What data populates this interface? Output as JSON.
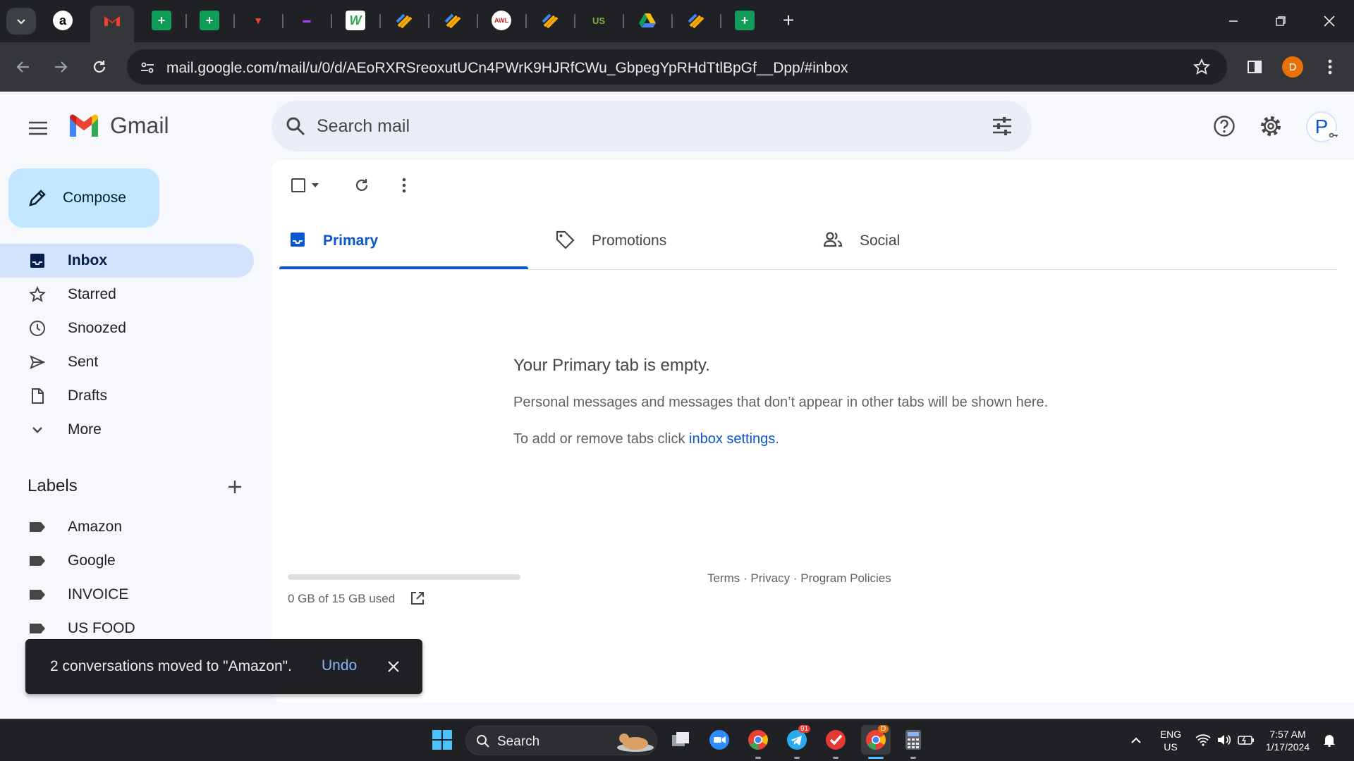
{
  "browser": {
    "url": "mail.google.com/mail/u/0/d/AEoRXRSreoxutUCn4PWrK9HJRfCWu_GbpegYpRHdTtlBpGf__Dpp/#inbox",
    "profile_initial": "D",
    "new_tab_symbol": "+",
    "tab_icons": [
      "amazon-icon",
      "gmail-icon",
      "sheets-icon",
      "sheets-icon",
      "app-icon",
      "app-icon",
      "w-icon",
      "app-icon",
      "app-icon",
      "awl-icon",
      "app-icon",
      "usfoods-icon",
      "drive-icon",
      "app-icon",
      "sheets-icon"
    ]
  },
  "gmail": {
    "logo_text": "Gmail",
    "search_placeholder": "Search mail",
    "avatar_initial": "P",
    "compose_label": "Compose",
    "nav": [
      {
        "label": "Inbox",
        "icon": "inbox-icon",
        "active": true
      },
      {
        "label": "Starred",
        "icon": "star-icon"
      },
      {
        "label": "Snoozed",
        "icon": "clock-icon"
      },
      {
        "label": "Sent",
        "icon": "send-icon"
      },
      {
        "label": "Drafts",
        "icon": "draft-icon"
      },
      {
        "label": "More",
        "icon": "chevron-down-icon"
      }
    ],
    "labels_heading": "Labels",
    "labels": [
      "Amazon",
      "Google",
      "INVOICE",
      "US FOOD"
    ],
    "tabs": [
      {
        "label": "Primary",
        "active": true
      },
      {
        "label": "Promotions"
      },
      {
        "label": "Social"
      }
    ],
    "empty": {
      "title": "Your Primary tab is empty.",
      "description": "Personal messages and messages that don’t appear in other tabs will be shown here.",
      "hint_prefix": "To add or remove tabs click ",
      "hint_link": "inbox settings",
      "hint_suffix": "."
    },
    "storage": {
      "text": "0 GB of 15 GB used",
      "used_fraction": 0
    },
    "footer": {
      "terms": "Terms",
      "privacy": "Privacy",
      "policies": "Program Policies",
      "separator": " · "
    },
    "snackbar": {
      "message": "2 conversations moved to \"Amazon\".",
      "action": "Undo"
    }
  },
  "taskbar": {
    "search_label": "Search",
    "lang_top": "ENG",
    "lang_bottom": "US",
    "time": "7:57 AM",
    "date": "1/17/2024",
    "telegram_badge": "91",
    "chrome_badge": "D"
  },
  "colors": {
    "accent": "#0b57d0",
    "compose_bg": "#c2e7ff",
    "active_nav_bg": "#d3e3fd",
    "search_bg": "#e9eef6"
  }
}
